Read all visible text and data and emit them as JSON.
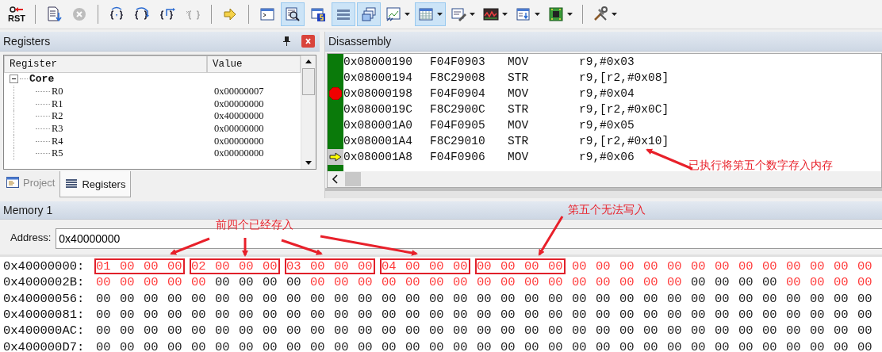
{
  "toolbar": [
    {
      "kind": "button",
      "label": "RST",
      "selected": false,
      "disabled": false,
      "dropdown": false
    },
    {
      "kind": "separator"
    },
    {
      "kind": "button",
      "selected": false,
      "disabled": false,
      "dropdown": false
    },
    {
      "kind": "button",
      "selected": false,
      "disabled": true,
      "dropdown": false
    },
    {
      "kind": "separator"
    },
    {
      "kind": "button",
      "selected": false,
      "disabled": false,
      "dropdown": false
    },
    {
      "kind": "button",
      "selected": false,
      "disabled": false,
      "dropdown": false
    },
    {
      "kind": "button",
      "selected": false,
      "disabled": false,
      "dropdown": false
    },
    {
      "kind": "button",
      "selected": false,
      "disabled": true,
      "dropdown": false
    },
    {
      "kind": "separator"
    },
    {
      "kind": "button",
      "selected": false,
      "disabled": false,
      "dropdown": false
    },
    {
      "kind": "separator"
    },
    {
      "kind": "button",
      "selected": false,
      "disabled": false,
      "dropdown": false
    },
    {
      "kind": "button",
      "selected": true,
      "disabled": false,
      "dropdown": false
    },
    {
      "kind": "button",
      "selected": false,
      "disabled": false,
      "dropdown": false
    },
    {
      "kind": "button",
      "selected": true,
      "disabled": false,
      "dropdown": false
    },
    {
      "kind": "button",
      "selected": true,
      "disabled": false,
      "dropdown": false
    },
    {
      "kind": "button",
      "selected": false,
      "disabled": false,
      "dropdown": true
    },
    {
      "kind": "button",
      "selected": true,
      "disabled": false,
      "dropdown": true
    },
    {
      "kind": "button",
      "selected": false,
      "disabled": false,
      "dropdown": true
    },
    {
      "kind": "button",
      "selected": false,
      "disabled": false,
      "dropdown": true
    },
    {
      "kind": "button",
      "selected": false,
      "disabled": false,
      "dropdown": true
    },
    {
      "kind": "button",
      "selected": false,
      "disabled": false,
      "dropdown": true
    },
    {
      "kind": "separator"
    },
    {
      "kind": "button",
      "selected": false,
      "disabled": false,
      "dropdown": true
    }
  ],
  "registers": {
    "title": "Registers",
    "columns": [
      "Register",
      "Value"
    ],
    "tree": [
      {
        "name": "Core",
        "expanded": true,
        "children": [
          {
            "name": "R0",
            "value": "0x00000007"
          },
          {
            "name": "R1",
            "value": "0x00000000"
          },
          {
            "name": "R2",
            "value": "0x40000000"
          },
          {
            "name": "R3",
            "value": "0x00000000"
          },
          {
            "name": "R4",
            "value": "0x00000000"
          },
          {
            "name": "R5",
            "value": "0x00000000"
          }
        ]
      }
    ],
    "tabs": [
      {
        "label": "Project",
        "selected": false
      },
      {
        "label": "Registers",
        "selected": true
      }
    ]
  },
  "disassembly": {
    "title": "Disassembly",
    "rows": [
      {
        "address": "0x08000190",
        "opcode": "F04F0903",
        "mnemonic": "MOV",
        "operands": "r9,#0x03",
        "executed": true,
        "breakpoint": false,
        "current": false
      },
      {
        "address": "0x08000194",
        "opcode": "F8C29008",
        "mnemonic": "STR",
        "operands": "r9,[r2,#0x08]",
        "executed": true,
        "breakpoint": false,
        "current": false
      },
      {
        "address": "0x08000198",
        "opcode": "F04F0904",
        "mnemonic": "MOV",
        "operands": "r9,#0x04",
        "executed": true,
        "breakpoint": true,
        "current": false
      },
      {
        "address": "0x0800019C",
        "opcode": "F8C2900C",
        "mnemonic": "STR",
        "operands": "r9,[r2,#0x0C]",
        "executed": true,
        "breakpoint": false,
        "current": false
      },
      {
        "address": "0x080001A0",
        "opcode": "F04F0905",
        "mnemonic": "MOV",
        "operands": "r9,#0x05",
        "executed": true,
        "breakpoint": false,
        "current": false
      },
      {
        "address": "0x080001A4",
        "opcode": "F8C29010",
        "mnemonic": "STR",
        "operands": "r9,[r2,#0x10]",
        "executed": true,
        "breakpoint": false,
        "current": false
      },
      {
        "address": "0x080001A8",
        "opcode": "F04F0906",
        "mnemonic": "MOV",
        "operands": "r9,#0x06",
        "executed": false,
        "breakpoint": false,
        "current": true
      }
    ]
  },
  "memory": {
    "title": "Memory 1",
    "address_label": "Address:",
    "address": "0x40000000",
    "rows": [
      {
        "address": "0x40000000:",
        "bytes": [
          {
            "value": "01",
            "changed": true,
            "boxed": true
          },
          {
            "value": "00",
            "changed": true,
            "boxed": true
          },
          {
            "value": "00",
            "changed": true,
            "boxed": true
          },
          {
            "value": "00",
            "changed": true,
            "boxed": true
          },
          {
            "value": "02",
            "changed": true,
            "boxed": true
          },
          {
            "value": "00",
            "changed": true,
            "boxed": true
          },
          {
            "value": "00",
            "changed": true,
            "boxed": true
          },
          {
            "value": "00",
            "changed": true,
            "boxed": true
          },
          {
            "value": "03",
            "changed": true,
            "boxed": true
          },
          {
            "value": "00",
            "changed": true,
            "boxed": true
          },
          {
            "value": "00",
            "changed": true,
            "boxed": true
          },
          {
            "value": "00",
            "changed": true,
            "boxed": true
          },
          {
            "value": "04",
            "changed": true,
            "boxed": true
          },
          {
            "value": "00",
            "changed": true,
            "boxed": true
          },
          {
            "value": "00",
            "changed": true,
            "boxed": true
          },
          {
            "value": "00",
            "changed": true,
            "boxed": true
          },
          {
            "value": "00",
            "changed": true,
            "boxed": true
          },
          {
            "value": "00",
            "changed": true,
            "boxed": true
          },
          {
            "value": "00",
            "changed": true,
            "boxed": true
          },
          {
            "value": "00",
            "changed": true,
            "boxed": true
          },
          {
            "value": "00",
            "changed": true,
            "boxed": false
          },
          {
            "value": "00",
            "changed": true,
            "boxed": false
          },
          {
            "value": "00",
            "changed": true,
            "boxed": false
          },
          {
            "value": "00",
            "changed": true,
            "boxed": false
          },
          {
            "value": "00",
            "changed": true,
            "boxed": false
          },
          {
            "value": "00",
            "changed": true,
            "boxed": false
          },
          {
            "value": "00",
            "changed": true,
            "boxed": false
          },
          {
            "value": "00",
            "changed": true,
            "boxed": false
          },
          {
            "value": "00",
            "changed": true,
            "boxed": false
          },
          {
            "value": "00",
            "changed": true,
            "boxed": false
          },
          {
            "value": "00",
            "changed": true,
            "boxed": false
          },
          {
            "value": "00",
            "changed": true,
            "boxed": false
          },
          {
            "value": "00",
            "changed": true,
            "boxed": false
          }
        ]
      },
      {
        "address": "0x4000002B:",
        "bytes": [
          {
            "value": "00",
            "changed": true
          },
          {
            "value": "00",
            "changed": true
          },
          {
            "value": "00",
            "changed": true
          },
          {
            "value": "00",
            "changed": true
          },
          {
            "value": "00",
            "changed": true
          },
          {
            "value": "00",
            "changed": false
          },
          {
            "value": "00",
            "changed": false
          },
          {
            "value": "00",
            "changed": false
          },
          {
            "value": "00",
            "changed": false
          },
          {
            "value": "00",
            "changed": true
          },
          {
            "value": "00",
            "changed": true
          },
          {
            "value": "00",
            "changed": true
          },
          {
            "value": "00",
            "changed": true
          },
          {
            "value": "00",
            "changed": true
          },
          {
            "value": "00",
            "changed": true
          },
          {
            "value": "00",
            "changed": true
          },
          {
            "value": "00",
            "changed": true
          },
          {
            "value": "00",
            "changed": true
          },
          {
            "value": "00",
            "changed": true
          },
          {
            "value": "00",
            "changed": true
          },
          {
            "value": "00",
            "changed": true
          },
          {
            "value": "00",
            "changed": true
          },
          {
            "value": "00",
            "changed": true
          },
          {
            "value": "00",
            "changed": true
          },
          {
            "value": "00",
            "changed": true
          },
          {
            "value": "00",
            "changed": false
          },
          {
            "value": "00",
            "changed": false
          },
          {
            "value": "00",
            "changed": false
          },
          {
            "value": "00",
            "changed": false
          },
          {
            "value": "00",
            "changed": true
          },
          {
            "value": "00",
            "changed": true
          },
          {
            "value": "00",
            "changed": true
          },
          {
            "value": "00",
            "changed": true
          }
        ]
      },
      {
        "address": "0x40000056:",
        "bytes": [
          {
            "value": "00",
            "changed": false
          },
          {
            "value": "00",
            "changed": false
          },
          {
            "value": "00",
            "changed": false
          },
          {
            "value": "00",
            "changed": false
          },
          {
            "value": "00",
            "changed": false
          },
          {
            "value": "00",
            "changed": false
          },
          {
            "value": "00",
            "changed": false
          },
          {
            "value": "00",
            "changed": false
          },
          {
            "value": "00",
            "changed": false
          },
          {
            "value": "00",
            "changed": false
          },
          {
            "value": "00",
            "changed": false
          },
          {
            "value": "00",
            "changed": false
          },
          {
            "value": "00",
            "changed": false
          },
          {
            "value": "00",
            "changed": false
          },
          {
            "value": "00",
            "changed": false
          },
          {
            "value": "00",
            "changed": false
          },
          {
            "value": "00",
            "changed": false
          },
          {
            "value": "00",
            "changed": false
          },
          {
            "value": "00",
            "changed": false
          },
          {
            "value": "00",
            "changed": false
          },
          {
            "value": "00",
            "changed": false
          },
          {
            "value": "00",
            "changed": false
          },
          {
            "value": "00",
            "changed": false
          },
          {
            "value": "00",
            "changed": false
          },
          {
            "value": "00",
            "changed": false
          },
          {
            "value": "00",
            "changed": false
          },
          {
            "value": "00",
            "changed": false
          },
          {
            "value": "00",
            "changed": false
          },
          {
            "value": "00",
            "changed": false
          },
          {
            "value": "00",
            "changed": false
          },
          {
            "value": "00",
            "changed": false
          },
          {
            "value": "00",
            "changed": false
          },
          {
            "value": "00",
            "changed": false
          }
        ]
      },
      {
        "address": "0x40000081:",
        "bytes": [
          {
            "value": "00",
            "changed": false
          },
          {
            "value": "00",
            "changed": false
          },
          {
            "value": "00",
            "changed": false
          },
          {
            "value": "00",
            "changed": false
          },
          {
            "value": "00",
            "changed": false
          },
          {
            "value": "00",
            "changed": false
          },
          {
            "value": "00",
            "changed": false
          },
          {
            "value": "00",
            "changed": false
          },
          {
            "value": "00",
            "changed": false
          },
          {
            "value": "00",
            "changed": false
          },
          {
            "value": "00",
            "changed": false
          },
          {
            "value": "00",
            "changed": false
          },
          {
            "value": "00",
            "changed": false
          },
          {
            "value": "00",
            "changed": false
          },
          {
            "value": "00",
            "changed": false
          },
          {
            "value": "00",
            "changed": false
          },
          {
            "value": "00",
            "changed": false
          },
          {
            "value": "00",
            "changed": false
          },
          {
            "value": "00",
            "changed": false
          },
          {
            "value": "00",
            "changed": false
          },
          {
            "value": "00",
            "changed": false
          },
          {
            "value": "00",
            "changed": false
          },
          {
            "value": "00",
            "changed": false
          },
          {
            "value": "00",
            "changed": false
          },
          {
            "value": "00",
            "changed": false
          },
          {
            "value": "00",
            "changed": false
          },
          {
            "value": "00",
            "changed": false
          },
          {
            "value": "00",
            "changed": false
          },
          {
            "value": "00",
            "changed": false
          },
          {
            "value": "00",
            "changed": false
          },
          {
            "value": "00",
            "changed": false
          },
          {
            "value": "00",
            "changed": false
          },
          {
            "value": "00",
            "changed": false
          }
        ]
      },
      {
        "address": "0x400000AC:",
        "bytes": [
          {
            "value": "00",
            "changed": false
          },
          {
            "value": "00",
            "changed": false
          },
          {
            "value": "00",
            "changed": false
          },
          {
            "value": "00",
            "changed": false
          },
          {
            "value": "00",
            "changed": false
          },
          {
            "value": "00",
            "changed": false
          },
          {
            "value": "00",
            "changed": false
          },
          {
            "value": "00",
            "changed": false
          },
          {
            "value": "00",
            "changed": false
          },
          {
            "value": "00",
            "changed": false
          },
          {
            "value": "00",
            "changed": false
          },
          {
            "value": "00",
            "changed": false
          },
          {
            "value": "00",
            "changed": false
          },
          {
            "value": "00",
            "changed": false
          },
          {
            "value": "00",
            "changed": false
          },
          {
            "value": "00",
            "changed": false
          },
          {
            "value": "00",
            "changed": false
          },
          {
            "value": "00",
            "changed": false
          },
          {
            "value": "00",
            "changed": false
          },
          {
            "value": "00",
            "changed": false
          },
          {
            "value": "00",
            "changed": false
          },
          {
            "value": "00",
            "changed": false
          },
          {
            "value": "00",
            "changed": false
          },
          {
            "value": "00",
            "changed": false
          },
          {
            "value": "00",
            "changed": false
          },
          {
            "value": "00",
            "changed": false
          },
          {
            "value": "00",
            "changed": false
          },
          {
            "value": "00",
            "changed": false
          },
          {
            "value": "00",
            "changed": false
          },
          {
            "value": "00",
            "changed": false
          },
          {
            "value": "00",
            "changed": false
          },
          {
            "value": "00",
            "changed": false
          },
          {
            "value": "00",
            "changed": false
          }
        ]
      },
      {
        "address": "0x400000D7:",
        "bytes": [
          {
            "value": "00",
            "changed": false
          },
          {
            "value": "00",
            "changed": false
          },
          {
            "value": "00",
            "changed": false
          },
          {
            "value": "00",
            "changed": false
          },
          {
            "value": "00",
            "changed": false
          },
          {
            "value": "00",
            "changed": false
          },
          {
            "value": "00",
            "changed": false
          },
          {
            "value": "00",
            "changed": false
          },
          {
            "value": "00",
            "changed": false
          },
          {
            "value": "00",
            "changed": false
          },
          {
            "value": "00",
            "changed": false
          },
          {
            "value": "00",
            "changed": false
          },
          {
            "value": "00",
            "changed": false
          },
          {
            "value": "00",
            "changed": false
          },
          {
            "value": "00",
            "changed": false
          },
          {
            "value": "00",
            "changed": false
          },
          {
            "value": "00",
            "changed": false
          },
          {
            "value": "00",
            "changed": false
          },
          {
            "value": "00",
            "changed": false
          },
          {
            "value": "00",
            "changed": false
          },
          {
            "value": "00",
            "changed": false
          },
          {
            "value": "00",
            "changed": false
          },
          {
            "value": "00",
            "changed": false
          },
          {
            "value": "00",
            "changed": false
          },
          {
            "value": "00",
            "changed": false
          },
          {
            "value": "00",
            "changed": false
          },
          {
            "value": "00",
            "changed": false
          },
          {
            "value": "00",
            "changed": false
          },
          {
            "value": "00",
            "changed": false
          },
          {
            "value": "00",
            "changed": false
          },
          {
            "value": "00",
            "changed": false
          },
          {
            "value": "00",
            "changed": false
          },
          {
            "value": "00",
            "changed": false
          }
        ]
      }
    ]
  },
  "annotations": [
    {
      "text": "前四个已经存入"
    },
    {
      "text": "第五个无法写入"
    },
    {
      "text": "已执行将第五个数字存入内存"
    }
  ]
}
